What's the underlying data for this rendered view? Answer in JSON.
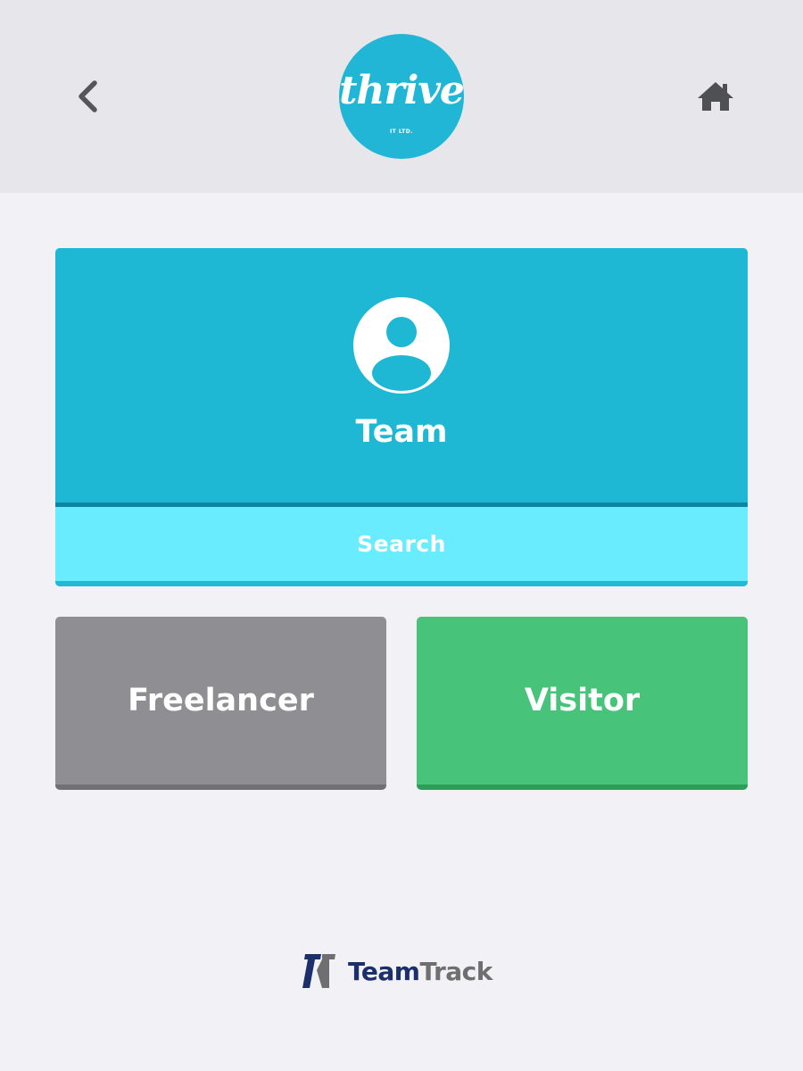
{
  "header": {
    "back_icon": "chevron-left-icon",
    "home_icon": "home-icon",
    "logo": {
      "word": "thrive",
      "sub": "IT LTD.",
      "color": "#21b6d5"
    }
  },
  "team_card": {
    "icon": "user-avatar-icon",
    "label": "Team",
    "search_label": "Search",
    "color": "#1eb7d4",
    "search_color": "#69ecfe"
  },
  "tiles": {
    "freelancer": {
      "label": "Freelancer",
      "color": "#8e8e93"
    },
    "visitor": {
      "label": "Visitor",
      "color": "#47c47a"
    }
  },
  "footer": {
    "brand_team": "Team",
    "brand_track": "Track",
    "brand_colors": {
      "team": "#1b2f6b",
      "track": "#6f6f6f"
    }
  }
}
